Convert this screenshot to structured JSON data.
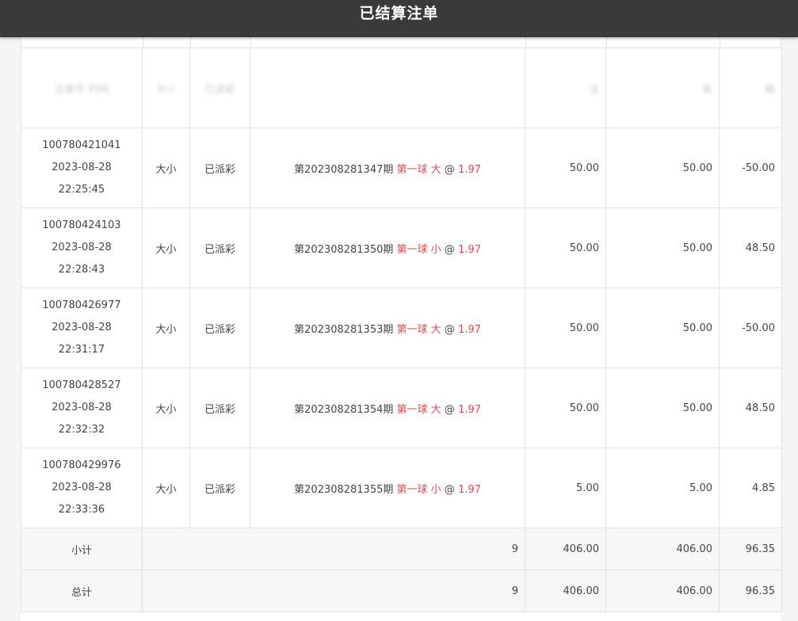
{
  "header": {
    "title": "已结算注单"
  },
  "blurred_header": {
    "col1": "注单号 时间",
    "col2": "大小",
    "col3": "已派彩",
    "col5": "注",
    "col6": "有",
    "col7": "输"
  },
  "rows": [
    {
      "id": "100780421041",
      "date": "2023-08-28",
      "time": "22:25:45",
      "type": "大小",
      "status": "已派彩",
      "period": "第202308281347期",
      "pick": "第一球 大",
      "at": "@",
      "odds": "1.97",
      "bet": "50.00",
      "valid": "50.00",
      "result": "-50.00",
      "result_neg": true
    },
    {
      "id": "100780424103",
      "date": "2023-08-28",
      "time": "22:28:43",
      "type": "大小",
      "status": "已派彩",
      "period": "第202308281350期",
      "pick": "第一球 小",
      "at": "@",
      "odds": "1.97",
      "bet": "50.00",
      "valid": "50.00",
      "result": "48.50",
      "result_neg": false
    },
    {
      "id": "100780426977",
      "date": "2023-08-28",
      "time": "22:31:17",
      "type": "大小",
      "status": "已派彩",
      "period": "第202308281353期",
      "pick": "第一球 大",
      "at": "@",
      "odds": "1.97",
      "bet": "50.00",
      "valid": "50.00",
      "result": "-50.00",
      "result_neg": true
    },
    {
      "id": "100780428527",
      "date": "2023-08-28",
      "time": "22:32:32",
      "type": "大小",
      "status": "已派彩",
      "period": "第202308281354期",
      "pick": "第一球 大",
      "at": "@",
      "odds": "1.97",
      "bet": "50.00",
      "valid": "50.00",
      "result": "48.50",
      "result_neg": false
    },
    {
      "id": "100780429976",
      "date": "2023-08-28",
      "time": "22:33:36",
      "type": "大小",
      "status": "已派彩",
      "period": "第202308281355期",
      "pick": "第一球 小",
      "at": "@",
      "odds": "1.97",
      "bet": "5.00",
      "valid": "5.00",
      "result": "4.85",
      "result_neg": false
    }
  ],
  "subtotal": {
    "label": "小计",
    "count": "9",
    "bet": "406.00",
    "valid": "406.00",
    "result": "96.35"
  },
  "total": {
    "label": "总计",
    "count": "9",
    "bet": "406.00",
    "valid": "406.00",
    "result": "96.35"
  },
  "colors": {
    "header_bg": "#3a3a3a",
    "accent_red": "#e5484d",
    "border": "#e2e2e2",
    "total_bg": "#f7f7f7"
  }
}
